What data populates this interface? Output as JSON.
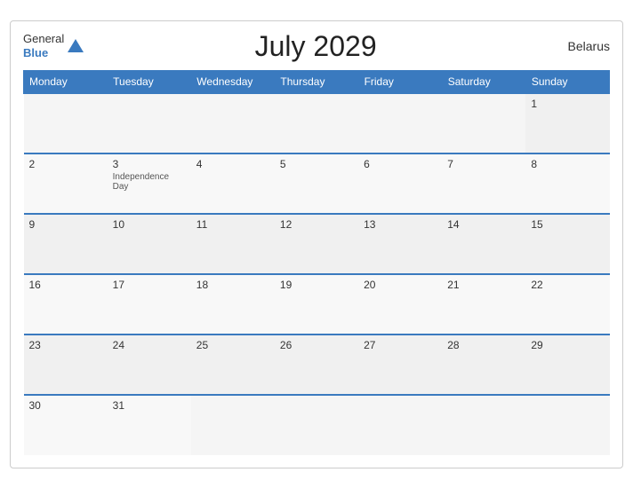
{
  "header": {
    "title": "July 2029",
    "country": "Belarus",
    "logo": {
      "general": "General",
      "blue": "Blue"
    }
  },
  "days": {
    "headers": [
      "Monday",
      "Tuesday",
      "Wednesday",
      "Thursday",
      "Friday",
      "Saturday",
      "Sunday"
    ]
  },
  "weeks": [
    [
      {
        "day": "",
        "empty": true
      },
      {
        "day": "",
        "empty": true
      },
      {
        "day": "",
        "empty": true
      },
      {
        "day": "",
        "empty": true
      },
      {
        "day": "",
        "empty": true
      },
      {
        "day": "",
        "empty": true
      },
      {
        "day": "1",
        "empty": false,
        "event": ""
      }
    ],
    [
      {
        "day": "2",
        "empty": false,
        "event": ""
      },
      {
        "day": "3",
        "empty": false,
        "event": "Independence Day"
      },
      {
        "day": "4",
        "empty": false,
        "event": ""
      },
      {
        "day": "5",
        "empty": false,
        "event": ""
      },
      {
        "day": "6",
        "empty": false,
        "event": ""
      },
      {
        "day": "7",
        "empty": false,
        "event": ""
      },
      {
        "day": "8",
        "empty": false,
        "event": ""
      }
    ],
    [
      {
        "day": "9",
        "empty": false,
        "event": ""
      },
      {
        "day": "10",
        "empty": false,
        "event": ""
      },
      {
        "day": "11",
        "empty": false,
        "event": ""
      },
      {
        "day": "12",
        "empty": false,
        "event": ""
      },
      {
        "day": "13",
        "empty": false,
        "event": ""
      },
      {
        "day": "14",
        "empty": false,
        "event": ""
      },
      {
        "day": "15",
        "empty": false,
        "event": ""
      }
    ],
    [
      {
        "day": "16",
        "empty": false,
        "event": ""
      },
      {
        "day": "17",
        "empty": false,
        "event": ""
      },
      {
        "day": "18",
        "empty": false,
        "event": ""
      },
      {
        "day": "19",
        "empty": false,
        "event": ""
      },
      {
        "day": "20",
        "empty": false,
        "event": ""
      },
      {
        "day": "21",
        "empty": false,
        "event": ""
      },
      {
        "day": "22",
        "empty": false,
        "event": ""
      }
    ],
    [
      {
        "day": "23",
        "empty": false,
        "event": ""
      },
      {
        "day": "24",
        "empty": false,
        "event": ""
      },
      {
        "day": "25",
        "empty": false,
        "event": ""
      },
      {
        "day": "26",
        "empty": false,
        "event": ""
      },
      {
        "day": "27",
        "empty": false,
        "event": ""
      },
      {
        "day": "28",
        "empty": false,
        "event": ""
      },
      {
        "day": "29",
        "empty": false,
        "event": ""
      }
    ],
    [
      {
        "day": "30",
        "empty": false,
        "event": ""
      },
      {
        "day": "31",
        "empty": false,
        "event": ""
      },
      {
        "day": "",
        "empty": true
      },
      {
        "day": "",
        "empty": true
      },
      {
        "day": "",
        "empty": true
      },
      {
        "day": "",
        "empty": true
      },
      {
        "day": "",
        "empty": true
      }
    ]
  ],
  "colors": {
    "header_bg": "#3a7abf",
    "accent": "#3a7abf"
  }
}
